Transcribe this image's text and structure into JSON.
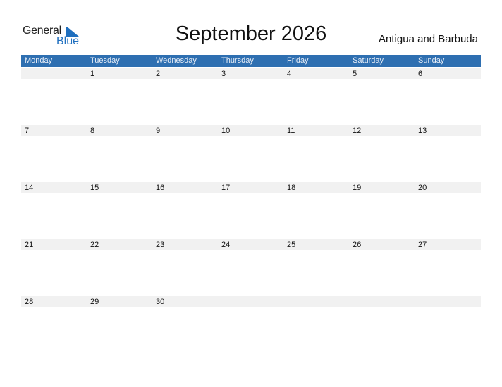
{
  "logo": {
    "word1": "General",
    "word2": "Blue"
  },
  "title": "September 2026",
  "country": "Antigua and Barbuda",
  "colors": {
    "accent": "#2e6fb1",
    "band": "#f1f1f1",
    "logo_blue": "#1f6fbf"
  },
  "weekdays": [
    "Monday",
    "Tuesday",
    "Wednesday",
    "Thursday",
    "Friday",
    "Saturday",
    "Sunday"
  ],
  "weeks": [
    [
      "",
      "1",
      "2",
      "3",
      "4",
      "5",
      "6"
    ],
    [
      "7",
      "8",
      "9",
      "10",
      "11",
      "12",
      "13"
    ],
    [
      "14",
      "15",
      "16",
      "17",
      "18",
      "19",
      "20"
    ],
    [
      "21",
      "22",
      "23",
      "24",
      "25",
      "26",
      "27"
    ],
    [
      "28",
      "29",
      "30",
      "",
      "",
      "",
      ""
    ]
  ]
}
